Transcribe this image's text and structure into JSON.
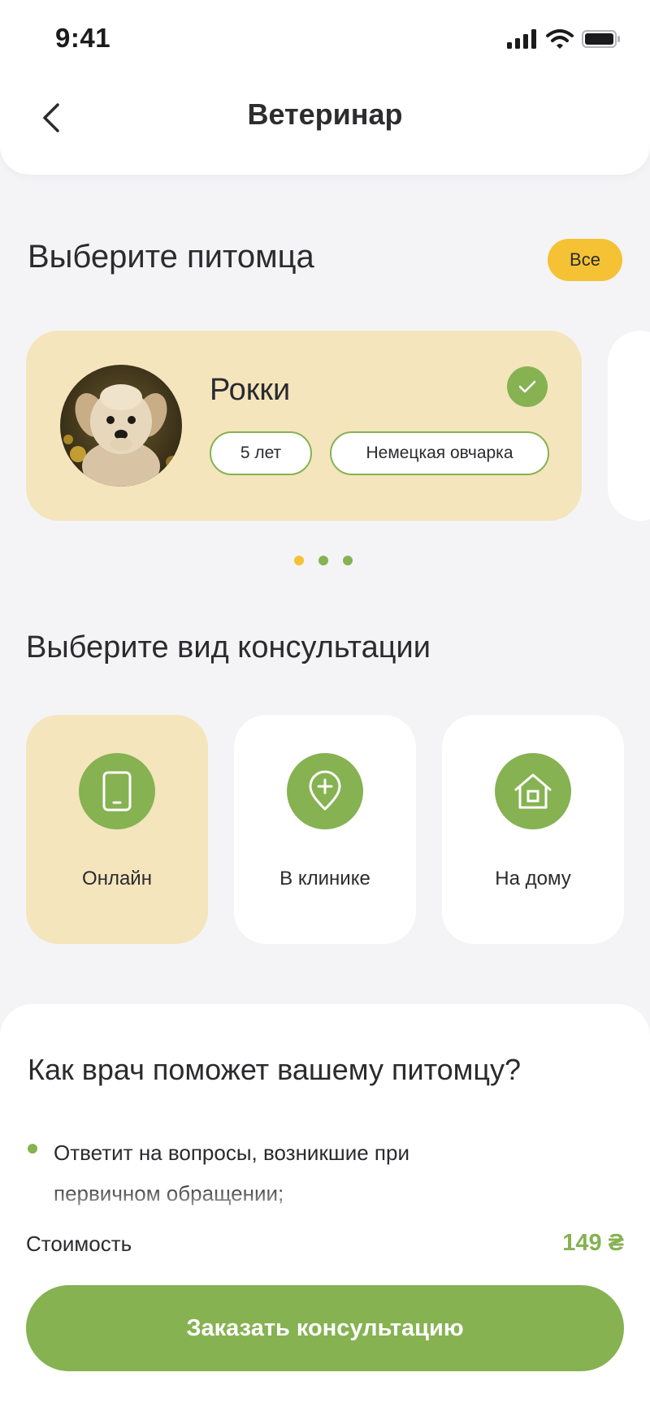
{
  "status_bar": {
    "time": "9:41"
  },
  "header": {
    "title": "Ветеринар"
  },
  "pet_section": {
    "title": "Выберите питомца",
    "all_button": "Все",
    "pet": {
      "name": "Рокки",
      "age": "5 лет",
      "breed": "Немецкая овчарка",
      "selected": true
    },
    "pagination": {
      "count": 3,
      "active_index": 0
    }
  },
  "consult_section": {
    "title": "Выберите вид консультации",
    "options": [
      {
        "label": "Онлайн",
        "icon": "phone-icon",
        "active": true
      },
      {
        "label": "В клинике",
        "icon": "location-plus-icon",
        "active": false
      },
      {
        "label": "На дому",
        "icon": "house-icon",
        "active": false
      }
    ]
  },
  "help_section": {
    "title": "Как врач поможет вашему питомцу?",
    "bullets": [
      "Ответит на вопросы, возникшие при первичном обращении;"
    ]
  },
  "price": {
    "label": "Стоимость",
    "value": "149 ₴"
  },
  "cta": {
    "label": "Заказать консультацию"
  },
  "colors": {
    "accent_green": "#86b252",
    "accent_yellow": "#f4c234",
    "card_beige": "#f4e5bd",
    "background": "#f4f4f7"
  }
}
